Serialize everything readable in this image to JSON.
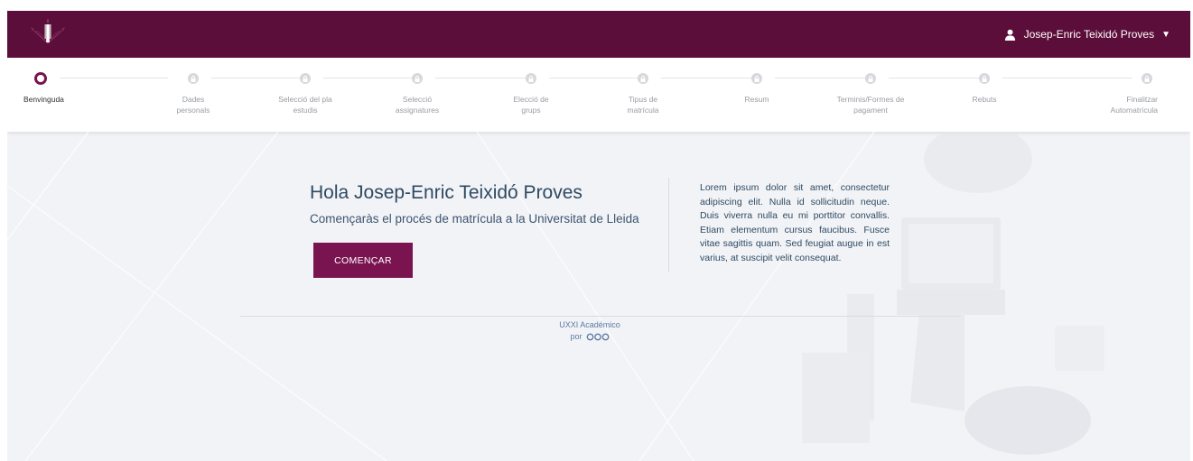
{
  "header": {
    "user_name": "Josep-Enric Teixidó Proves",
    "brand_color": "#5c0e3a"
  },
  "stepper": {
    "active_index": 0,
    "steps": [
      {
        "label": "Benvinguda",
        "state": "active"
      },
      {
        "label": "Dades personals",
        "state": "locked"
      },
      {
        "label": "Selecció del pla estudis",
        "state": "locked"
      },
      {
        "label": "Selecció assignatures",
        "state": "locked"
      },
      {
        "label": "Elecció de grups",
        "state": "locked"
      },
      {
        "label": "Tipus de matrícula",
        "state": "locked"
      },
      {
        "label": "Resum",
        "state": "locked"
      },
      {
        "label": "Terminis/Formes de pagament",
        "state": "locked"
      },
      {
        "label": "Rebuts",
        "state": "locked"
      },
      {
        "label": "Finalitzar Automatrícula",
        "state": "locked"
      }
    ]
  },
  "hero": {
    "greeting": "Hola Josep-Enric Teixidó Proves",
    "subtitle": "Començaràs el procés de matrícula a la Universitat de Lleida",
    "start_button": "COMENÇAR",
    "info_text": "Lorem ipsum dolor sit amet, consectetur adipiscing elit. Nulla id sollicitudin neque. Duis viverra nulla eu mi porttitor convallis. Etiam elementum cursus faucibus. Fusce vitae sagittis quam. Sed feugiat augue in est varius, at suscipit velit consequat."
  },
  "footer": {
    "product": "UXXI Académico",
    "por": "por"
  },
  "colors": {
    "accent": "#7a1450",
    "text_heading": "#2d4a63",
    "footer_link": "#5b7aa5"
  }
}
